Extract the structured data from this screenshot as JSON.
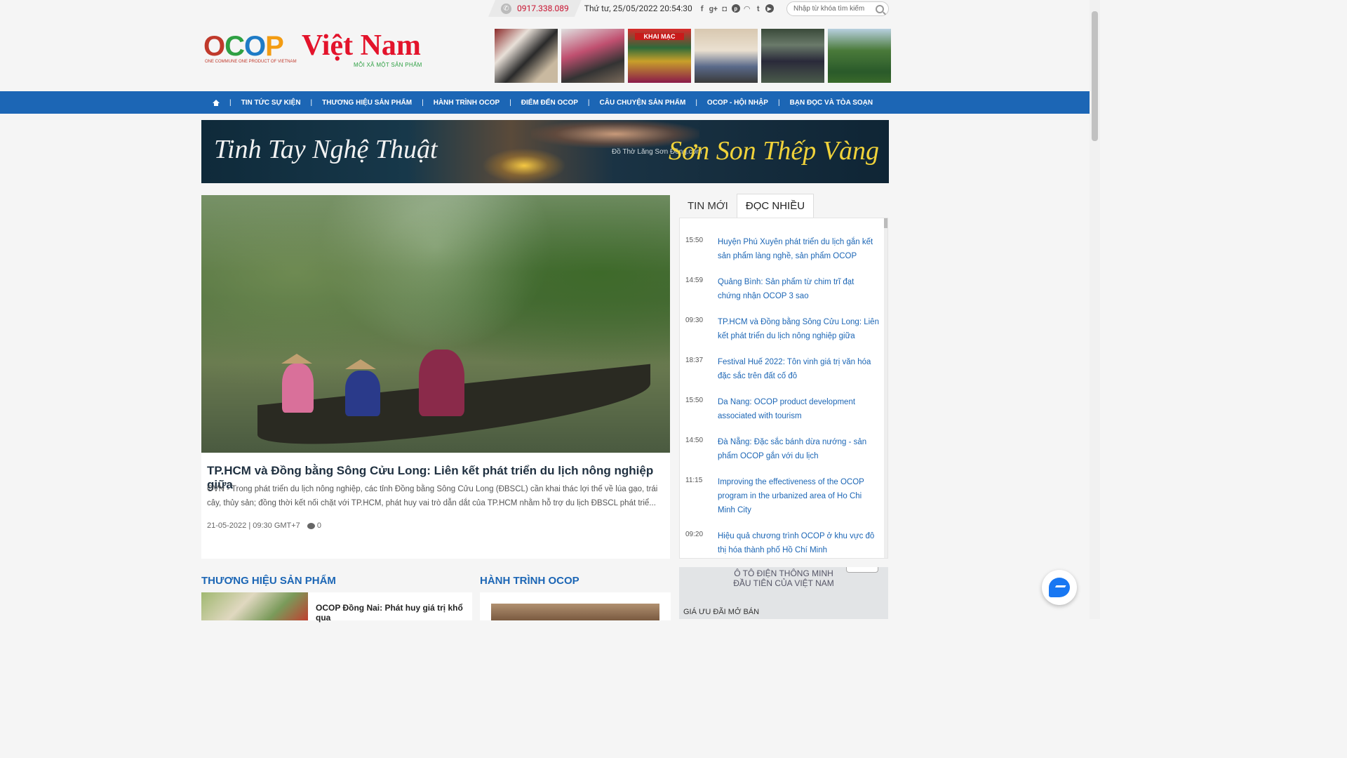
{
  "topbar": {
    "hotline": "0917.338.089",
    "datetime": "Thứ tư, 25/05/2022 20:54:30",
    "socials": [
      "facebook-icon",
      "google-plus-icon",
      "instagram-icon",
      "pinterest-icon",
      "rss-icon",
      "twitter-icon",
      "youtube-icon"
    ],
    "search_placeholder": "Nhập từ khóa tìm kiếm"
  },
  "logo": {
    "ocop_letters": [
      "O",
      "C",
      "O",
      "P"
    ],
    "name": "Việt Nam",
    "tagline_en": "ONE COMMUNE ONE PRODUCT OF VIETNAM",
    "tagline_vi": "MỖI XÃ MỘT SẢN PHẨM"
  },
  "header_thumbs": [
    {
      "label": ""
    },
    {
      "label": ""
    },
    {
      "label": "KHAI MẠC"
    },
    {
      "label": ""
    },
    {
      "label": ""
    },
    {
      "label": ""
    }
  ],
  "nav": {
    "items": [
      "TIN TỨC SỰ KIỆN",
      "THƯƠNG HIỆU SẢN PHẨM",
      "HÀNH TRÌNH OCOP",
      "ĐIỂM ĐẾN OCOP",
      "CÂU CHUYỆN SẢN PHẨM",
      "OCOP - HỘI NHẬP",
      "BẠN ĐỌC VÀ TÒA SOẠN"
    ],
    "separator": "|"
  },
  "banner": {
    "left_text": "Tinh Tay Nghệ Thuật",
    "brand": "Đồ Thờ Lăng Sơn Đồng.com",
    "right_text": "Sơn Son Thếp Vàng"
  },
  "main_article": {
    "title": "TP.HCM và Đồng bằng Sông Cửu Long: Liên kết phát triển du lịch nông nghiệp giữa",
    "summary": "OVN - Trong phát triển du lịch nông nghiệp, các tỉnh Đồng bằng Sông Cửu Long (ĐBSCL) cần khai thác lợi thế về lúa gạo, trái cây, thủy sản; đồng thời kết nối chặt với TP.HCM, phát huy vai trò dẫn dắt của TP.HCM nhằm hỗ trợ du lịch ĐBSCL phát triể...",
    "date": "21-05-2022 | 09:30 GMT+7",
    "comments": "0"
  },
  "sidebar": {
    "tabs": [
      "TIN MỚI",
      "ĐỌC NHIỀU"
    ],
    "active_tab": "ĐỌC NHIỀU",
    "news": [
      {
        "time": "15:50",
        "title": "Huyện Phú Xuyên phát triển du lịch gắn kết sản phẩm làng nghề, sản phẩm OCOP"
      },
      {
        "time": "14:59",
        "title": "Quảng Bình: Sản phẩm từ chim trĩ đạt chứng nhận OCOP 3 sao"
      },
      {
        "time": "09:30",
        "title": "TP.HCM và Đồng bằng Sông Cửu Long: Liên kết phát triển du lịch nông nghiệp giữa"
      },
      {
        "time": "18:37",
        "title": "Festival Huế 2022: Tôn vinh giá trị văn hóa đặc sắc trên đất cố đô"
      },
      {
        "time": "15:50",
        "title": "Da Nang: OCOP product development associated with tourism"
      },
      {
        "time": "14:50",
        "title": "Đà Nẵng: Đặc sắc bánh dừa nướng - sản phẩm OCOP gắn với du lịch"
      },
      {
        "time": "11:15",
        "title": "Improving the effectiveness of the OCOP program in the urbanized area of Ho Chi Minh City"
      },
      {
        "time": "09:20",
        "title": "Hiệu quả chương trình OCOP ở khu vực đô thị hóa thành phố Hồ Chí Minh"
      }
    ]
  },
  "sections": {
    "brand_title": "THƯƠNG HIỆU SẢN PHẨM",
    "brand_item": "OCOP Đồng Nai: Phát huy giá trị khổ qua",
    "journey_title": "HÀNH TRÌNH OCOP"
  },
  "ad": {
    "line1": "Ô TÔ ĐIỆN THÔNG MINH",
    "line2": "ĐẦU TIÊN CỦA VIỆT NAM",
    "line3": "GIÁ ƯU ĐÃI MỞ BÁN"
  },
  "colors": {
    "nav_blue": "#1c66b5",
    "hotline_red": "#c8102e",
    "link_blue": "#1c66b5"
  }
}
